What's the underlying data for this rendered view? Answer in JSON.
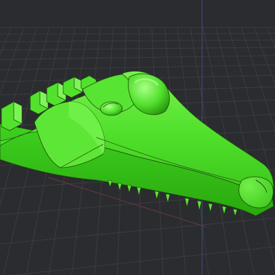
{
  "viewport": {
    "background_color": "#2b2c2f",
    "grid_color": "#3e4045",
    "axis_color_x": "#7a4045",
    "axis_color_y": "#3c5478",
    "model_color": "#4fe02a",
    "model_shadow_color": "#2ea010",
    "model_highlight_color": "#8cf76a",
    "outline_color": "#1a3a0c",
    "model_name": "crocodile-head-model"
  }
}
